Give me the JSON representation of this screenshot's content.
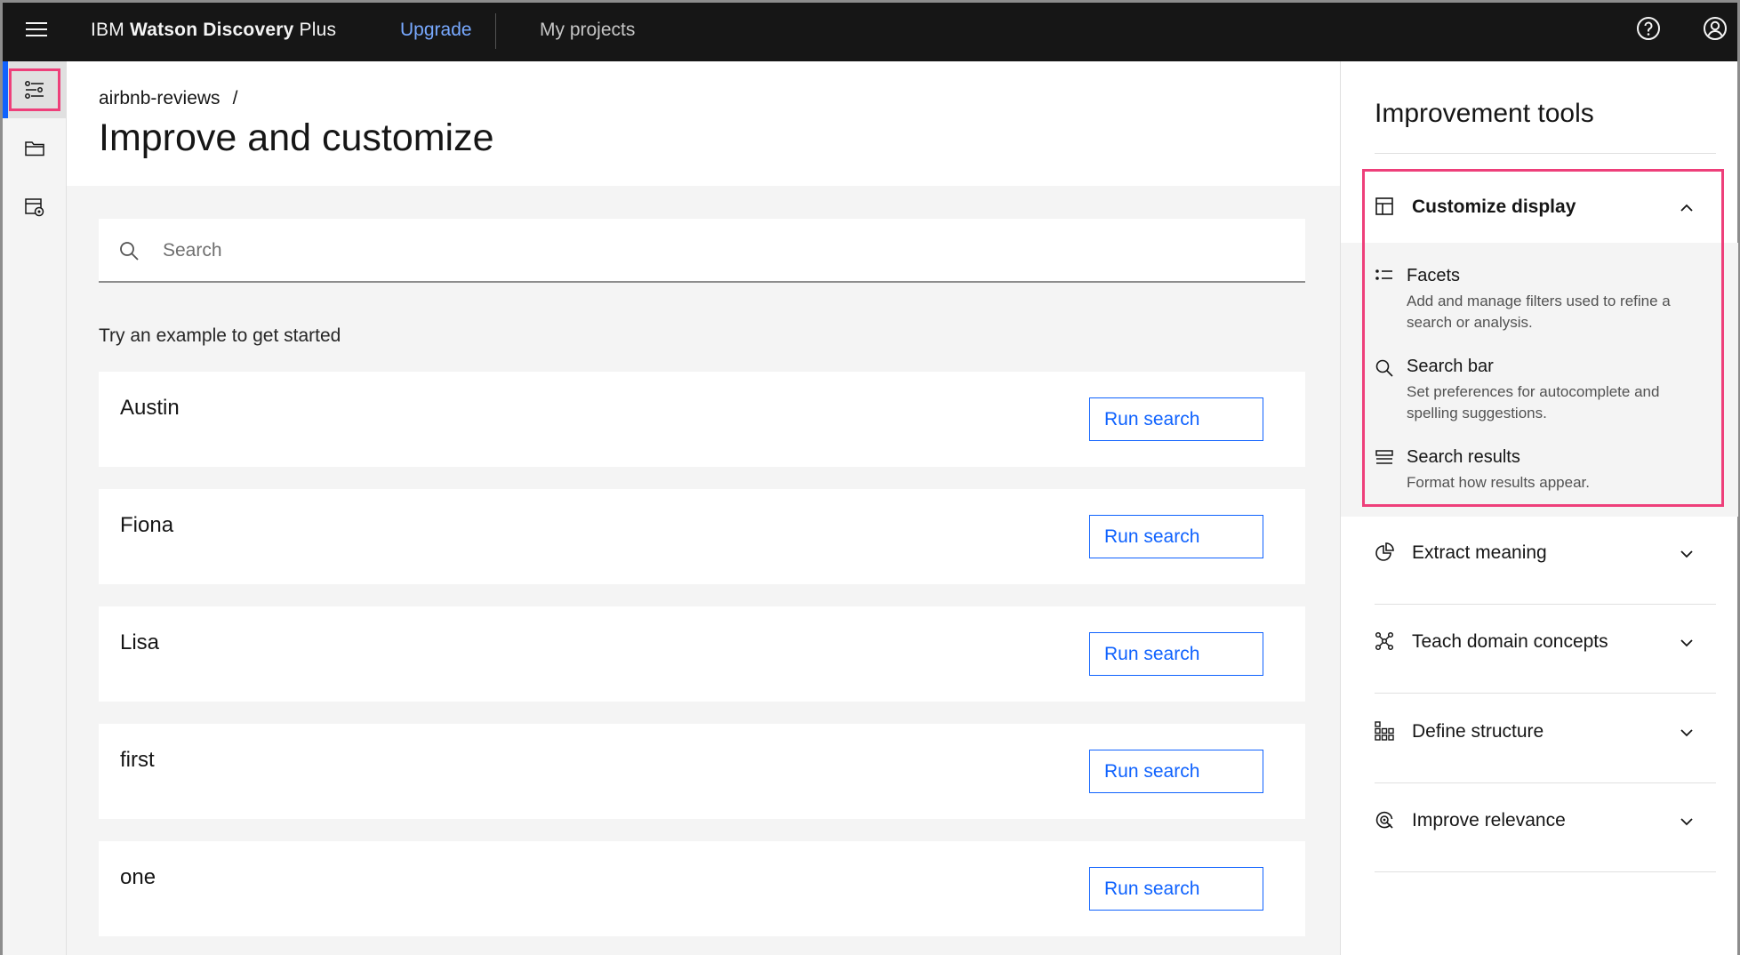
{
  "header": {
    "brand_prefix": "IBM",
    "brand_name": "Watson Discovery",
    "brand_suffix": "Plus",
    "upgrade_label": "Upgrade",
    "projects_label": "My projects",
    "icons": [
      "menu-icon",
      "help-icon",
      "user-icon"
    ]
  },
  "leftrail": {
    "items": [
      {
        "icon": "settings-adjust-icon",
        "active": true
      },
      {
        "icon": "folder-icon",
        "active": false
      },
      {
        "icon": "data-settings-icon",
        "active": false
      }
    ]
  },
  "main": {
    "breadcrumb": "airbnb-reviews",
    "breadcrumb_sep": "/",
    "title": "Improve and customize",
    "search_placeholder": "Search",
    "examples_heading": "Try an example to get started",
    "examples": [
      {
        "label": "Austin",
        "button": "Run search"
      },
      {
        "label": "Fiona",
        "button": "Run search"
      },
      {
        "label": "Lisa",
        "button": "Run search"
      },
      {
        "label": "first",
        "button": "Run search"
      },
      {
        "label": "one",
        "button": "Run search"
      }
    ]
  },
  "panel": {
    "title": "Improvement tools",
    "customize": {
      "label": "Customize display",
      "icon": "layout-icon",
      "expanded": true,
      "items": [
        {
          "title": "Facets",
          "desc": "Add and manage filters used to refine a search or analysis.",
          "icon": "list-bulleted-icon"
        },
        {
          "title": "Search bar",
          "desc": "Set preferences for autocomplete and spelling suggestions.",
          "icon": "search-icon"
        },
        {
          "title": "Search results",
          "desc": "Format how results appear.",
          "icon": "list-boxes-icon"
        }
      ]
    },
    "sections": [
      {
        "label": "Extract meaning",
        "icon": "chart-pie-icon"
      },
      {
        "label": "Teach domain concepts",
        "icon": "network-icon"
      },
      {
        "label": "Define structure",
        "icon": "grid-structure-icon"
      },
      {
        "label": "Improve relevance",
        "icon": "target-relevance-icon"
      }
    ]
  },
  "colors": {
    "header_bg": "#161616",
    "accent": "#0f62fe",
    "link_light": "#78a9ff",
    "highlight": "#ee3f7a",
    "surface": "#f4f4f4"
  }
}
